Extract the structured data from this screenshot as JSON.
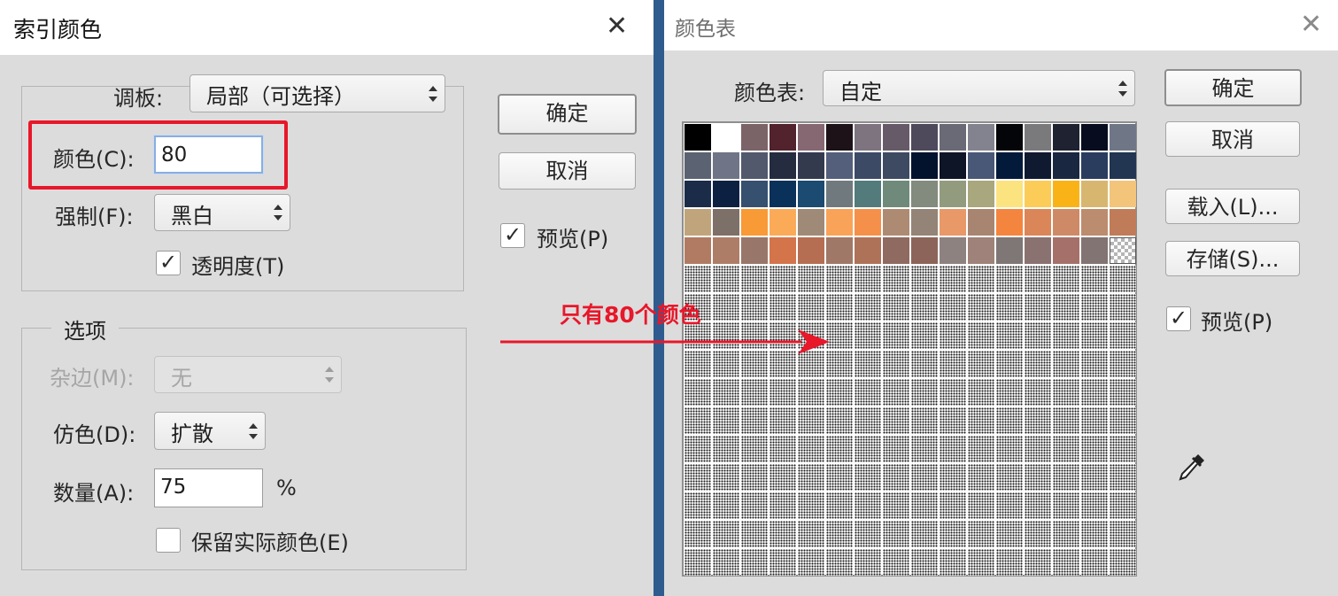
{
  "index_color_dialog": {
    "title": "索引颜色",
    "close_glyph": "✕",
    "palette_label": "调板:",
    "palette_value": "局部（可选择）",
    "colors_label": "颜色(C):",
    "colors_value": "80",
    "forced_label": "强制(F):",
    "forced_value": "黑白",
    "transparency_label": "透明度(T)",
    "transparency_checked": true,
    "options_legend": "选项",
    "matte_label": "杂边(M):",
    "matte_value": "无",
    "dither_label": "仿色(D):",
    "dither_value": "扩散",
    "amount_label": "数量(A):",
    "amount_value": "75",
    "amount_unit": "%",
    "preserve_label": "保留实际颜色(E)",
    "preserve_checked": false,
    "ok_label": "确定",
    "cancel_label": "取消",
    "preview_label": "预览(P)",
    "preview_checked": true
  },
  "color_table_dialog": {
    "title": "颜色表",
    "close_glyph": "✕",
    "table_label": "颜色表:",
    "table_value": "自定",
    "ok_label": "确定",
    "cancel_label": "取消",
    "load_label": "载入(L)...",
    "save_label": "存储(S)...",
    "preview_label": "预览(P)",
    "preview_checked": true,
    "eyedropper_icon": "eyedropper-icon",
    "swatches": [
      "#000000",
      "#ffffff",
      "#7b6468",
      "#52222d",
      "#866872",
      "#1c1217",
      "#7d7480",
      "#675a68",
      "#4e4a5c",
      "#6a6a76",
      "#838390",
      "#040508",
      "#7a7a7c",
      "#1f2230",
      "#070d1e",
      "#6f7787",
      "#5b6272",
      "#6f7587",
      "#53596d",
      "#252c40",
      "#343a4e",
      "#545f7b",
      "#3d4a66",
      "#3e4a62",
      "#04132d",
      "#0e1526",
      "#4a5877",
      "#041a3a",
      "#0f1a31",
      "#1a2740",
      "#2b3d5f",
      "#223551",
      "#1b2c49",
      "#0c2141",
      "#36506f",
      "#0a3159",
      "#1b4b71",
      "#707a7e",
      "#537b7b",
      "#6f8a7a",
      "#838a7e",
      "#939b7f",
      "#a9a77d",
      "#fbe380",
      "#fccc58",
      "#fab316",
      "#d7b770",
      "#f3c57b",
      "#c0a57c",
      "#7c7068",
      "#f89a36",
      "#fbab58",
      "#9e8a77",
      "#f9a358",
      "#f5904a",
      "#ad8b73",
      "#938477",
      "#e99868",
      "#a88571",
      "#f4853e",
      "#da8658",
      "#ce8a66",
      "#bc8c6f",
      "#c07c59",
      "#b07b62",
      "#ad7d68",
      "#98776a",
      "#d4744b",
      "#b56e52",
      "#a07867",
      "#ae7258",
      "#8f6a60",
      "#8c6459",
      "#8e8280",
      "#9f8279",
      "#7e7776",
      "#8a7270",
      "#a5706a",
      "#827472",
      "trans"
    ],
    "total_slots": 256
  },
  "annotation": {
    "text": "只有80个颜色",
    "color": "#e8172a"
  }
}
